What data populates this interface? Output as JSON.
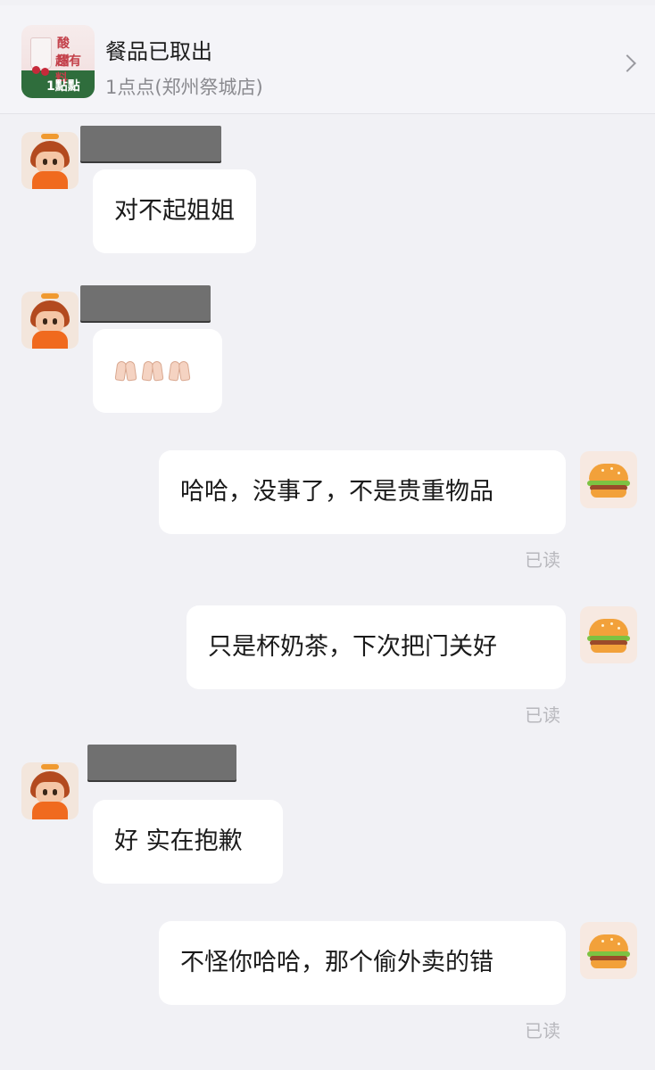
{
  "header": {
    "thumb_line1": "酸 甜",
    "thumb_line2": "超有料",
    "thumb_logo": "1點點",
    "title": "餐品已取出",
    "subtitle": "1点点(郑州祭城店)"
  },
  "messages": [
    {
      "side": "left",
      "text": "对不起姐姐",
      "avatar": "courier-avatar"
    },
    {
      "side": "left",
      "text": "🙏🙏🙏",
      "avatar": "courier-avatar"
    },
    {
      "side": "right",
      "text": "哈哈，没事了，不是贵重物品",
      "status": "已读",
      "avatar": "burger-avatar"
    },
    {
      "side": "right",
      "text": "只是杯奶茶，下次把门关好",
      "status": "已读",
      "avatar": "burger-avatar"
    },
    {
      "side": "left",
      "text": "好 实在抱歉",
      "avatar": "courier-avatar"
    },
    {
      "side": "right",
      "text": "不怪你哈哈，那个偷外卖的错",
      "status": "已读",
      "avatar": "burger-avatar"
    }
  ]
}
